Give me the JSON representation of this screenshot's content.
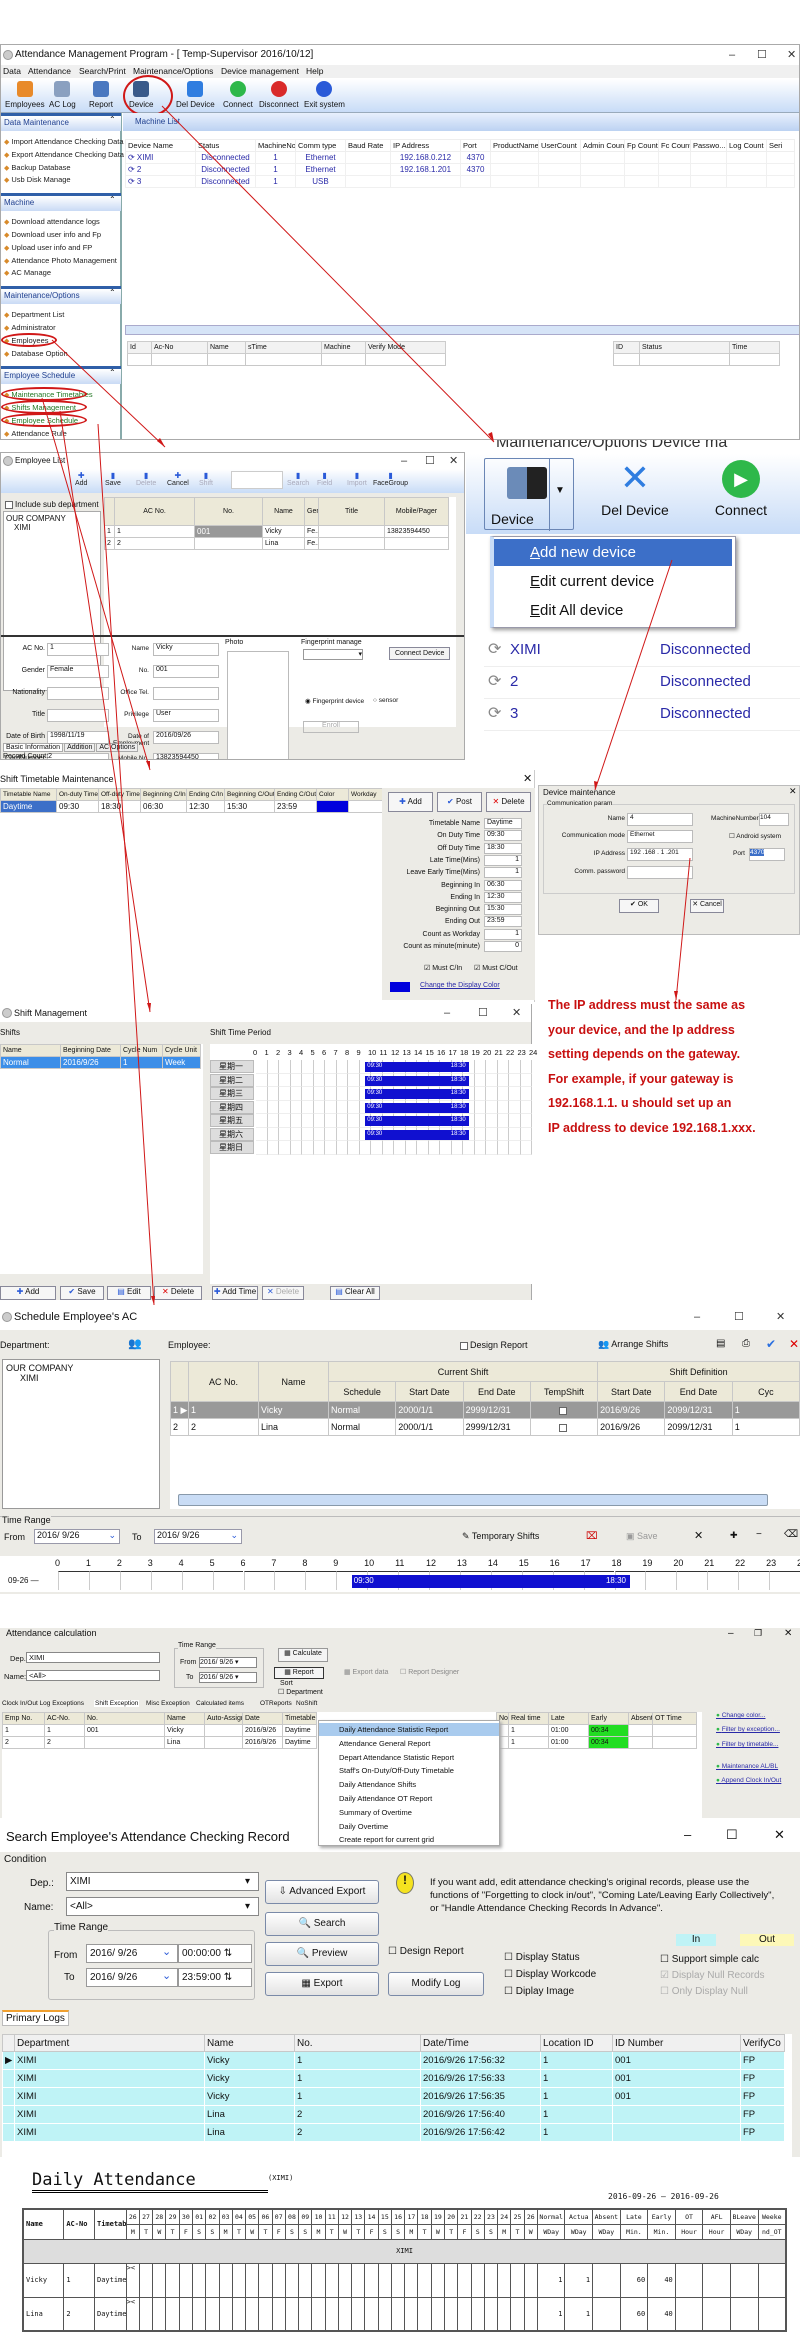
{
  "main": {
    "title": "Attendance Management Program - [ Temp-Supervisor 2016/10/12]",
    "menu": [
      "Data",
      "Attendance",
      "Search/Print",
      "Maintenance/Options",
      "Device management",
      "Help"
    ],
    "toolbar": [
      "Employees",
      "AC Log",
      "Report",
      "Device",
      "Del Device",
      "Connect",
      "Disconnect",
      "Exit system"
    ],
    "machine_list_label": "Machine List",
    "sidebar": [
      {
        "header": "Data Maintenance",
        "items": [
          "Import Attendance Checking Data",
          "Export Attendance Checking Data",
          "Backup Database",
          "Usb Disk Manage"
        ]
      },
      {
        "header": "Machine",
        "items": [
          "Download attendance logs",
          "Download user info and Fp",
          "Upload user info and FP",
          "Attendance Photo Management",
          "AC Manage"
        ]
      },
      {
        "header": "Maintenance/Options",
        "items": [
          "Department List",
          "Administrator",
          "Employees",
          "Database Option"
        ]
      },
      {
        "header": "Employee Schedule",
        "items": [
          "Maintenance Timetables",
          "Shifts Management",
          "Employee Schedule",
          "Attendance Rule"
        ]
      }
    ],
    "device_table": {
      "headers": [
        "Device Name",
        "Status",
        "MachineNo.",
        "Comm type",
        "Baud Rate",
        "IP Address",
        "Port",
        "ProductName",
        "UserCount",
        "Admin Count",
        "Fp Count",
        "Fc Count",
        "Passwo...",
        "Log Count",
        "Seri"
      ],
      "rows": [
        [
          "XIMI",
          "Disconnected",
          "1",
          "Ethernet",
          "",
          "192.168.0.212",
          "4370"
        ],
        [
          "2",
          "Disconnected",
          "1",
          "Ethernet",
          "",
          "192.168.1.201",
          "4370"
        ],
        [
          "3",
          "Disconnected",
          "1",
          "USB",
          "",
          "",
          ""
        ]
      ]
    },
    "log_table": {
      "headers": [
        "Id",
        "Ac-No",
        "Name",
        "sTime",
        "Machine",
        "Verify Mode"
      ]
    },
    "status_table": {
      "headers": [
        "ID",
        "Status",
        "Time"
      ]
    }
  },
  "employee_list": {
    "title": "Employee List",
    "toolbar": [
      "Add",
      "Save",
      "Delete",
      "Cancel",
      "Shift",
      "Search",
      "Field",
      "Import",
      "FaceGroup"
    ],
    "include_sub": "Include sub department",
    "tree": [
      "OUR COMPANY",
      "XIMI"
    ],
    "grid_headers": [
      "",
      "AC No.",
      "No.",
      "Name",
      "Gende",
      "Title",
      "Mobile/Pager"
    ],
    "grid_rows": [
      [
        "1",
        "1",
        "001",
        "Vicky",
        "Fe...",
        "",
        "13823594450"
      ],
      [
        "2",
        "2",
        "",
        "Lina",
        "Fe...",
        "",
        ""
      ]
    ],
    "grid_footer": "2",
    "form": {
      "ac_no_label": "AC No.",
      "ac_no": "1",
      "name_label": "Name",
      "name": "Vicky",
      "photo_label": "Photo",
      "fp_label": "Fingerprint manage",
      "gender_label": "Gender",
      "gender": "Female",
      "no_label": "No.",
      "no": "001",
      "connect_device": "Connect Device",
      "nationality_label": "Nationality",
      "office_tel_label": "Office Tel.",
      "title_label": "Title",
      "privilege_label": "Privilege",
      "privilege": "User",
      "fp_device": "Fingerprint device",
      "sensor": "sensor",
      "enroll": "Enroll",
      "dob_label": "Date of Birth",
      "dob": "1998/11/19",
      "doe_label": "Date of Employment",
      "doe": "2016/09/26",
      "card_label": "CardNumber",
      "mobile_label": "Mobile No.",
      "mobile": "13823594450",
      "home_label": "Home Add."
    },
    "tabs": [
      "Basic Information",
      "Addition",
      "AC Options"
    ],
    "record_count": "Record Count:2"
  },
  "device_zoom": {
    "breadcrumb": "Maintenance/Options    Device ma",
    "buttons": [
      "Device",
      "Del Device",
      "Connect"
    ],
    "menu": [
      "Add new device",
      "Edit current device",
      "Edit All device"
    ],
    "rows": [
      [
        "XIMI",
        "Disconnected"
      ],
      [
        "2",
        "Disconnected"
      ],
      [
        "3",
        "Disconnected"
      ]
    ]
  },
  "timetable": {
    "title": "Shift Timetable Maintenance",
    "headers": [
      "Timetable Name",
      "On-duty Time",
      "Off-duty Time",
      "Beginning C/In",
      "Ending C/In",
      "Beginning C/Out",
      "Ending C/Out",
      "Color",
      "Workday"
    ],
    "row": [
      "Daytime",
      "09:30",
      "18:30",
      "06:30",
      "12:30",
      "15:30",
      "23:59"
    ],
    "buttons": [
      "Add",
      "Post",
      "Delete"
    ],
    "fields": [
      [
        "Timetable Name",
        "Daytime"
      ],
      [
        "On Duty Time",
        "09:30"
      ],
      [
        "Off Duty Time",
        "18:30"
      ],
      [
        "Late Time(Mins)",
        "1"
      ],
      [
        "Leave Early Time(Mins)",
        "1"
      ],
      [
        "Beginning In",
        "06:30"
      ],
      [
        "Ending In",
        "12:30"
      ],
      [
        "Beginning Out",
        "15:30"
      ],
      [
        "Ending Out",
        "23:59"
      ],
      [
        "Count as Workday",
        "1"
      ],
      [
        "Count as minute(minute)",
        "0"
      ]
    ],
    "must_in": "Must C/In",
    "must_out": "Must C/Out",
    "change_color": "Change the Display Color",
    "color": "#0000dd"
  },
  "device_maint": {
    "title": "Device maintenance",
    "group": "Communication param",
    "name_label": "Name",
    "name": "4",
    "machine_label": "MachineNumber",
    "machine": "104",
    "mode_label": "Communication mode",
    "mode": "Ethernet",
    "android": "Android system",
    "ip_label": "IP Address",
    "ip": "192 .168 . 1 .201",
    "port_label": "Port",
    "port": "4370",
    "pwd_label": "Comm. password",
    "ok": "OK",
    "cancel": "Cancel"
  },
  "note": [
    "The IP address must the same as",
    "your device, and the Ip address",
    "setting depends on the gateway.",
    "For example, if your gateway is",
    "192.168.1.1. u should set up an",
    "IP address to device 192.168.1.xxx."
  ],
  "shift_mgmt": {
    "title": "Shift Management",
    "shifts_label": "Shifts",
    "period_label": "Shift Time Period",
    "headers": [
      "Name",
      "Beginning Date",
      "Cycle Num",
      "Cycle Unit"
    ],
    "row": [
      "Normal",
      "2016/9/26",
      "1",
      "Week"
    ],
    "hours": [
      "0",
      "1",
      "2",
      "3",
      "4",
      "5",
      "6",
      "7",
      "8",
      "9",
      "10",
      "11",
      "12",
      "13",
      "14",
      "15",
      "16",
      "17",
      "18",
      "19",
      "20",
      "21",
      "22",
      "23",
      "24"
    ],
    "days": [
      "星期一",
      "星期二",
      "星期三",
      "星期四",
      "星期五",
      "星期六",
      "星期日"
    ],
    "period": {
      "start": "09:30",
      "end": "18:30",
      "start_h": 9.5,
      "end_h": 18.5,
      "active_days": 6
    },
    "buttons": [
      "Add",
      "Save",
      "Edit",
      "Delete",
      "Add Time",
      "Delete",
      "Clear All"
    ]
  },
  "schedule": {
    "title": "Schedule Employee's AC",
    "department": "Department:",
    "employee": "Employee:",
    "design_report": "Design Report",
    "arrange": "Arrange Shifts",
    "tree": [
      "OUR COMPANY",
      "XIMI"
    ],
    "group_current": "Current Shift",
    "group_def": "Shift Definition",
    "headers": [
      "AC No.",
      "Name",
      "Schedule",
      "Start Date",
      "End Date",
      "TempShift",
      "Start Date",
      "End Date",
      "Cyc"
    ],
    "rows": [
      [
        "1",
        "1",
        "Vicky",
        "Normal",
        "2000/1/1",
        "2999/12/31",
        "",
        "2016/9/26",
        "2099/12/31",
        "1"
      ],
      [
        "2",
        "2",
        "Lina",
        "Normal",
        "2000/1/1",
        "2999/12/31",
        "",
        "2016/9/26",
        "2099/12/31",
        "1"
      ]
    ],
    "time_range": "Time Range",
    "from_label": "From",
    "from": "2016/ 9/26",
    "to_label": "To",
    "to": "2016/ 9/26",
    "temp_shifts": "Temporary Shifts",
    "save": "Save",
    "date_row": "09-26",
    "bar": {
      "start": "09:30",
      "end": "18:30",
      "start_h": 9.5,
      "end_h": 18.5
    }
  },
  "calc": {
    "title": "Attendance calculation",
    "dep_label": "Dep.:",
    "dep": "XIMI",
    "name_label": "Name:",
    "name": "<All>",
    "time_range": "Time Range",
    "from_label": "From",
    "from": "2016/ 9/26",
    "to_label": "To",
    "to": "2016/ 9/26",
    "calculate": "Calculate",
    "report": "Report",
    "export": "Export data",
    "report_designer": "Report Designer",
    "sort": "Sort",
    "department": "Department",
    "tabs": [
      "Clock In/Out Log Exceptions",
      "Shift Exception",
      "Misc Exception",
      "Calculated items",
      "OTReports",
      "NoShift"
    ],
    "menu": [
      "Daily Attendance Statistic Report",
      "Attendance General Report",
      "Depart Attendance Statistic Report",
      "Staff's On-Duty/Off-Duty Timetable",
      "Daily Attendance Shifts",
      "Daily Attendance OT Report",
      "Summary of Overtime",
      "Daily Overtime",
      "Create report for current grid"
    ],
    "headers": [
      "Emp No.",
      "AC-No.",
      "No.",
      "Name",
      "Auto-Assign",
      "Date",
      "Timetable"
    ],
    "rows": [
      [
        "1",
        "1",
        "001",
        "Vicky",
        "",
        "2016/9/26",
        "Daytime"
      ],
      [
        "2",
        "2",
        "",
        "Lina",
        "",
        "2016/9/26",
        "Daytime"
      ]
    ],
    "right_headers": [
      "Normal",
      "Real time",
      "Late",
      "Early",
      "Absent",
      "OT Time"
    ],
    "right_rows": [
      [
        "",
        "1",
        "01:00",
        "00:34",
        "",
        ""
      ],
      [
        "",
        "1",
        "01:00",
        "00:34",
        "",
        ""
      ]
    ],
    "links": [
      "Change color...",
      "Filter by exception...",
      "Filter by timetable...",
      "Maintenance AL/BL",
      "Append Clock In/Out"
    ]
  },
  "search": {
    "title": "Search Employee's Attendance Checking Record",
    "condition": "Condition",
    "dep_label": "Dep.:",
    "dep": "XIMI",
    "name_label": "Name:",
    "name": "<All>",
    "time_range": "Time Range",
    "from_label": "From",
    "to_label": "To",
    "from_date": "2016/ 9/26",
    "from_time": "00:00:00",
    "to_date": "2016/ 9/26",
    "to_time": "23:59:00",
    "advanced_export": "Advanced Export",
    "search": "Search",
    "preview": "Preview",
    "export": "Export",
    "design_report": "Design Report",
    "modify_log": "Modify Log",
    "hint": "If you want add, edit attendance checking's original records, please use the functions of \"Forgetting to clock in/out\", \"Coming Late/Leaving Early Collectively\", or \"Handle Attendance Checking Records In Advance\".",
    "in": "In",
    "out": "Out",
    "checks": [
      "Display Status",
      "Display Workcode",
      "Diplay Image"
    ],
    "checks2": [
      "Support simple calc",
      "Display Null Records",
      "Only Display Null"
    ],
    "tab": "Primary Logs",
    "headers": [
      "Department",
      "Name",
      "No.",
      "Date/Time",
      "Location ID",
      "ID Number",
      "VerifyCo"
    ],
    "rows": [
      [
        "XIMI",
        "Vicky",
        "1",
        "2016/9/26 17:56:32",
        "1",
        "001",
        "FP"
      ],
      [
        "XIMI",
        "Vicky",
        "1",
        "2016/9/26 17:56:33",
        "1",
        "001",
        "FP"
      ],
      [
        "XIMI",
        "Vicky",
        "1",
        "2016/9/26 17:56:35",
        "1",
        "001",
        "FP"
      ],
      [
        "XIMI",
        "Lina",
        "2",
        "2016/9/26 17:56:40",
        "1",
        "",
        "FP"
      ],
      [
        "XIMI",
        "Lina",
        "2",
        "2016/9/26 17:56:42",
        "1",
        "",
        "FP"
      ]
    ]
  },
  "daily": {
    "title": "Daily Attendance",
    "dept": "(XIMI)",
    "range": "2016-09-26 — 2016-09-26",
    "fixed_headers": [
      "Name",
      "AC-No",
      "Timetable"
    ],
    "days": [
      [
        "26",
        "M"
      ],
      [
        "27",
        "T"
      ],
      [
        "28",
        "W"
      ],
      [
        "29",
        "T"
      ],
      [
        "30",
        "F"
      ],
      [
        "01",
        "S"
      ],
      [
        "02",
        "S"
      ],
      [
        "03",
        "M"
      ],
      [
        "04",
        "T"
      ],
      [
        "05",
        "W"
      ],
      [
        "06",
        "T"
      ],
      [
        "07",
        "F"
      ],
      [
        "08",
        "S"
      ],
      [
        "09",
        "S"
      ],
      [
        "10",
        "M"
      ],
      [
        "11",
        "T"
      ],
      [
        "12",
        "W"
      ],
      [
        "13",
        "T"
      ],
      [
        "14",
        "F"
      ],
      [
        "15",
        "S"
      ],
      [
        "16",
        "S"
      ],
      [
        "17",
        "M"
      ],
      [
        "18",
        "T"
      ],
      [
        "19",
        "W"
      ],
      [
        "20",
        "T"
      ],
      [
        "21",
        "F"
      ],
      [
        "22",
        "S"
      ],
      [
        "23",
        "S"
      ],
      [
        "24",
        "M"
      ],
      [
        "25",
        "T"
      ],
      [
        "26",
        "W"
      ]
    ],
    "stat_headers": [
      [
        "Normal",
        "WDay"
      ],
      [
        "Actua",
        "WDay"
      ],
      [
        "Absent",
        "WDay"
      ],
      [
        "Late",
        "Min."
      ],
      [
        "Early",
        "Min."
      ],
      [
        "OT",
        "Hour"
      ],
      [
        "AFL",
        "Hour"
      ],
      [
        "BLeave",
        "WDay"
      ],
      [
        "Weeke",
        "nd_OT"
      ]
    ],
    "group": "XIMI",
    "rows": [
      {
        "name": "Vicky",
        "ac": "1",
        "tt": "Daytime",
        "mark": "><",
        "stats": [
          "1",
          "1",
          "",
          "60",
          "40",
          "",
          "",
          "",
          ""
        ]
      },
      {
        "name": "Lina",
        "ac": "2",
        "tt": "Daytime",
        "mark": "><",
        "stats": [
          "1",
          "1",
          "",
          "60",
          "40",
          "",
          "",
          "",
          ""
        ]
      }
    ]
  }
}
